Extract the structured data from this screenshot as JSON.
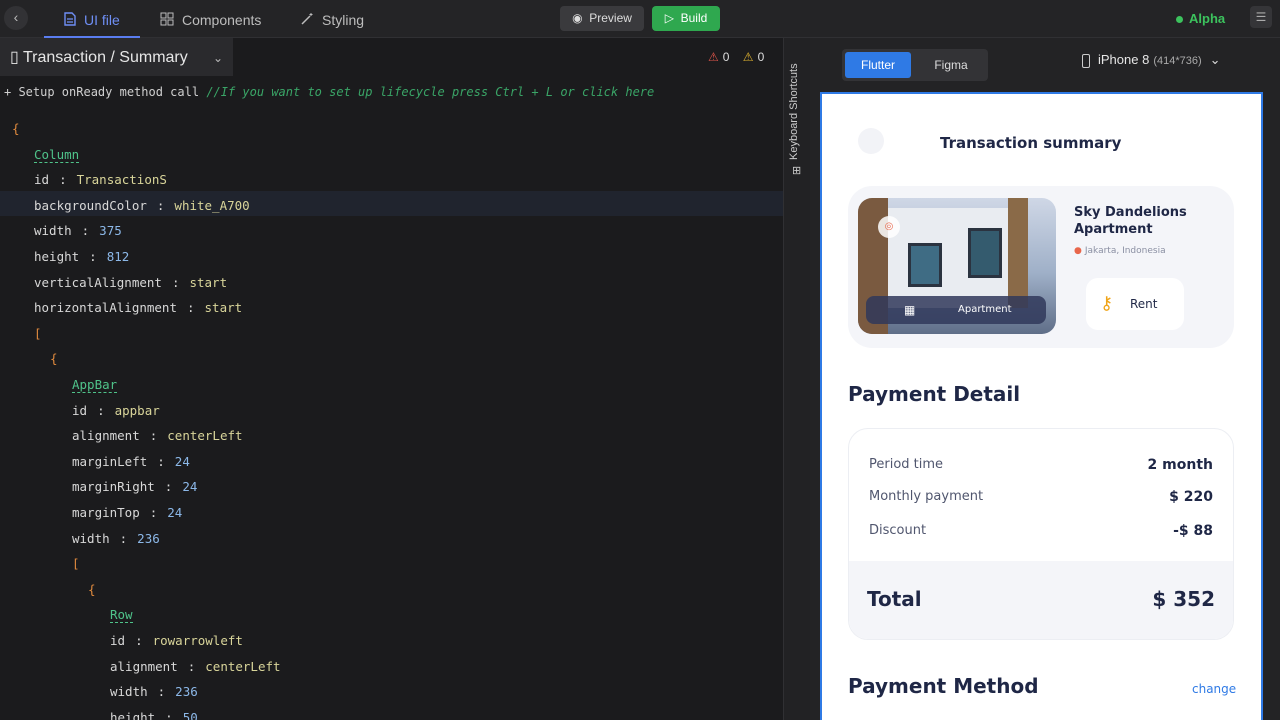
{
  "topbar": {
    "tabs": [
      {
        "label": "UI file",
        "icon": "file-icon"
      },
      {
        "label": "Components",
        "icon": "grid-icon"
      },
      {
        "label": "Styling",
        "icon": "magic-wand-icon"
      }
    ],
    "preview_label": "Preview",
    "build_label": "Build",
    "status_label": "Alpha",
    "status_color": "#3cc25d",
    "accent_color": "#5a7df0"
  },
  "editor": {
    "file_title": "Transaction / Summary",
    "errors_count": "0",
    "warnings_count": "0",
    "setup_text": "+ Setup onReady method call",
    "setup_comment": "//If you want to set up lifecycle press Ctrl + L or click here",
    "lines": [
      {
        "brace": "{"
      },
      {
        "type": "Column"
      },
      {
        "key": "id",
        "str": "TransactionS"
      },
      {
        "key": "backgroundColor",
        "str": "white_A700"
      },
      {
        "key": "width",
        "num": "375"
      },
      {
        "key": "height",
        "num": "812"
      },
      {
        "key": "verticalAlignment",
        "str": "start"
      },
      {
        "key": "horizontalAlignment",
        "str": "start"
      },
      {
        "bracket": "["
      },
      {
        "brace": "{"
      },
      {
        "type": "AppBar"
      },
      {
        "key": "id",
        "str": "appbar"
      },
      {
        "key": "alignment",
        "str": "centerLeft"
      },
      {
        "key": "marginLeft",
        "num": "24"
      },
      {
        "key": "marginRight",
        "num": "24"
      },
      {
        "key": "marginTop",
        "num": "24"
      },
      {
        "key": "width",
        "num": "236"
      },
      {
        "bracket": "["
      },
      {
        "brace": "{"
      },
      {
        "type": "Row"
      },
      {
        "key": "id",
        "str": "rowarrowleft"
      },
      {
        "key": "alignment",
        "str": "centerLeft"
      },
      {
        "key": "width",
        "num": "236"
      },
      {
        "key": "height",
        "num": "50"
      }
    ]
  },
  "sidebar": {
    "keyboard_shortcuts_label": "Keyboard Shortcuts"
  },
  "preview": {
    "modes": [
      "Flutter",
      "Figma"
    ],
    "device_name": "iPhone 8",
    "device_dims": "(414*736)"
  },
  "phone": {
    "title": "Transaction summary",
    "property": {
      "name": "Sky Dandelions Apartment",
      "location": "Jakarta, Indonesia",
      "image_label": "Apartment",
      "rent_label": "Rent"
    },
    "payment_detail": {
      "heading": "Payment Detail",
      "rows": [
        {
          "label": "Period time",
          "value": "2 month"
        },
        {
          "label": "Monthly payment",
          "value": "$ 220"
        },
        {
          "label": "Discount",
          "value": "-$ 88"
        }
      ],
      "total_label": "Total",
      "total_value": "$ 352"
    },
    "payment_method": {
      "heading": "Payment Method",
      "change_label": "change"
    }
  }
}
